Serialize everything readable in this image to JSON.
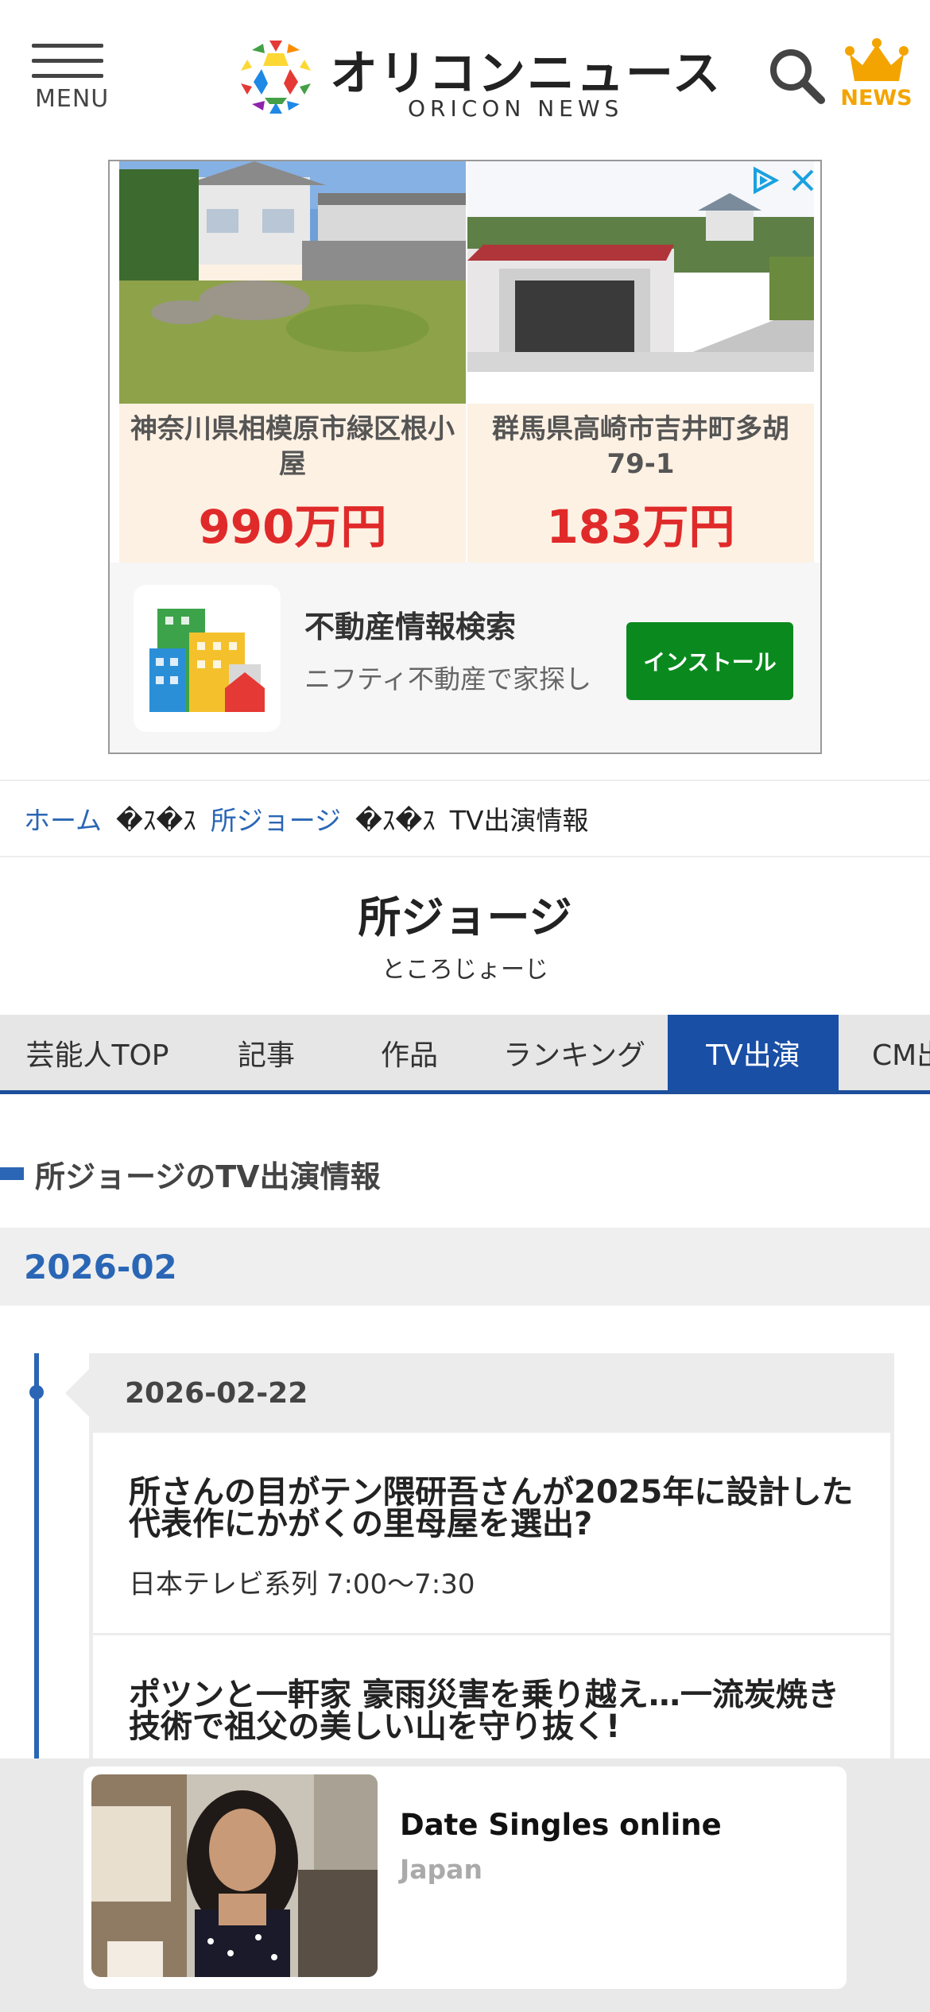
{
  "header": {
    "menu_label": "MENU",
    "logo_jp": "オリコンニュース",
    "logo_en": "ORICON NEWS",
    "news_label": "NEWS",
    "icons": [
      "hamburger-menu-icon",
      "search-icon",
      "crown-icon"
    ]
  },
  "ad": {
    "listings": [
      {
        "location": "神奈川県相模原市緑区根小屋",
        "price": "990万円"
      },
      {
        "location": "群馬県高崎市吉井町多胡79-1",
        "price": "183万円"
      }
    ],
    "app_title": "不動産情報検索",
    "app_subtitle": "ニフティ不動産で家探し",
    "install_label": "インストール",
    "icons": [
      "adchoices-icon",
      "close-icon",
      "building-app-icon"
    ]
  },
  "breadcrumb": {
    "home": "ホーム",
    "separator": "�ｽ�ｽ",
    "artist": "所ジョージ",
    "current": "TV出演情報"
  },
  "artist": {
    "name": "所ジョージ",
    "reading": "ところじょーじ"
  },
  "tabs": [
    {
      "label": "芸能人TOP",
      "active": false
    },
    {
      "label": "記事",
      "active": false
    },
    {
      "label": "作品",
      "active": false
    },
    {
      "label": "ランキング",
      "active": false
    },
    {
      "label": "TV出演",
      "active": true
    },
    {
      "label": "CM出演",
      "active": false
    }
  ],
  "section": {
    "heading": "所ジョージのTV出演情報",
    "month": "2026-02",
    "date": "2026-02-22"
  },
  "programs": [
    {
      "title": "所さんの目がテン隈研吾さんが2025年に設計した代表作にかがくの里母屋を選出?",
      "channel": "日本テレビ系列 7:00～7:30"
    },
    {
      "title": "ポツンと一軒家 豪雨災害を乗り越え…一流炭焼き技術で祖父の美しい山を守り抜く!",
      "channel": ""
    }
  ],
  "bottom_ad": {
    "title": "Date Singles online",
    "subtitle": "Japan"
  },
  "colors": {
    "accent_blue": "#2a66b5",
    "tab_active": "#1a4fa6",
    "price_red": "#e02a2a",
    "install_green": "#0a8a1e",
    "crown_orange": "#f3a400"
  }
}
